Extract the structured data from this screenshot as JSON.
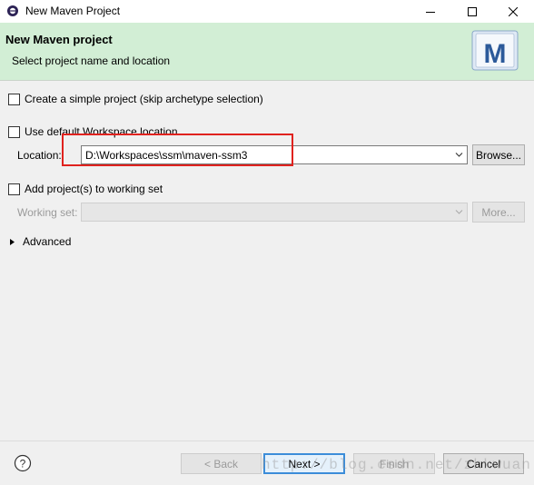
{
  "window": {
    "title": "New Maven Project",
    "icons": {
      "app": "eclipse-app-icon",
      "minimize": "minimize-icon",
      "maximize": "maximize-icon",
      "close": "close-icon"
    }
  },
  "header": {
    "title": "New Maven project",
    "subtitle": "Select project name and location",
    "logo_letter": "M"
  },
  "options": {
    "simple_project": {
      "label": "Create a simple project (skip archetype selection)",
      "checked": false
    },
    "default_workspace": {
      "label": "Use default Workspace location",
      "checked": false
    },
    "location": {
      "label": "Location:",
      "value": "D:\\Workspaces\\ssm\\maven-ssm3",
      "browse": "Browse..."
    },
    "working_set_toggle": {
      "label": "Add project(s) to working set",
      "checked": false
    },
    "working_set": {
      "label": "Working set:",
      "value": "",
      "more": "More..."
    },
    "advanced": {
      "label": "Advanced"
    }
  },
  "footer": {
    "back": "< Back",
    "next": "Next >",
    "finish": "Finish",
    "cancel": "Cancel",
    "watermark": "http://blog.csdn.net/zhkwuan"
  },
  "colors": {
    "header_bg": "#d2eed5",
    "highlight": "#e0221e",
    "default_button_border": "#3c8dd9"
  }
}
